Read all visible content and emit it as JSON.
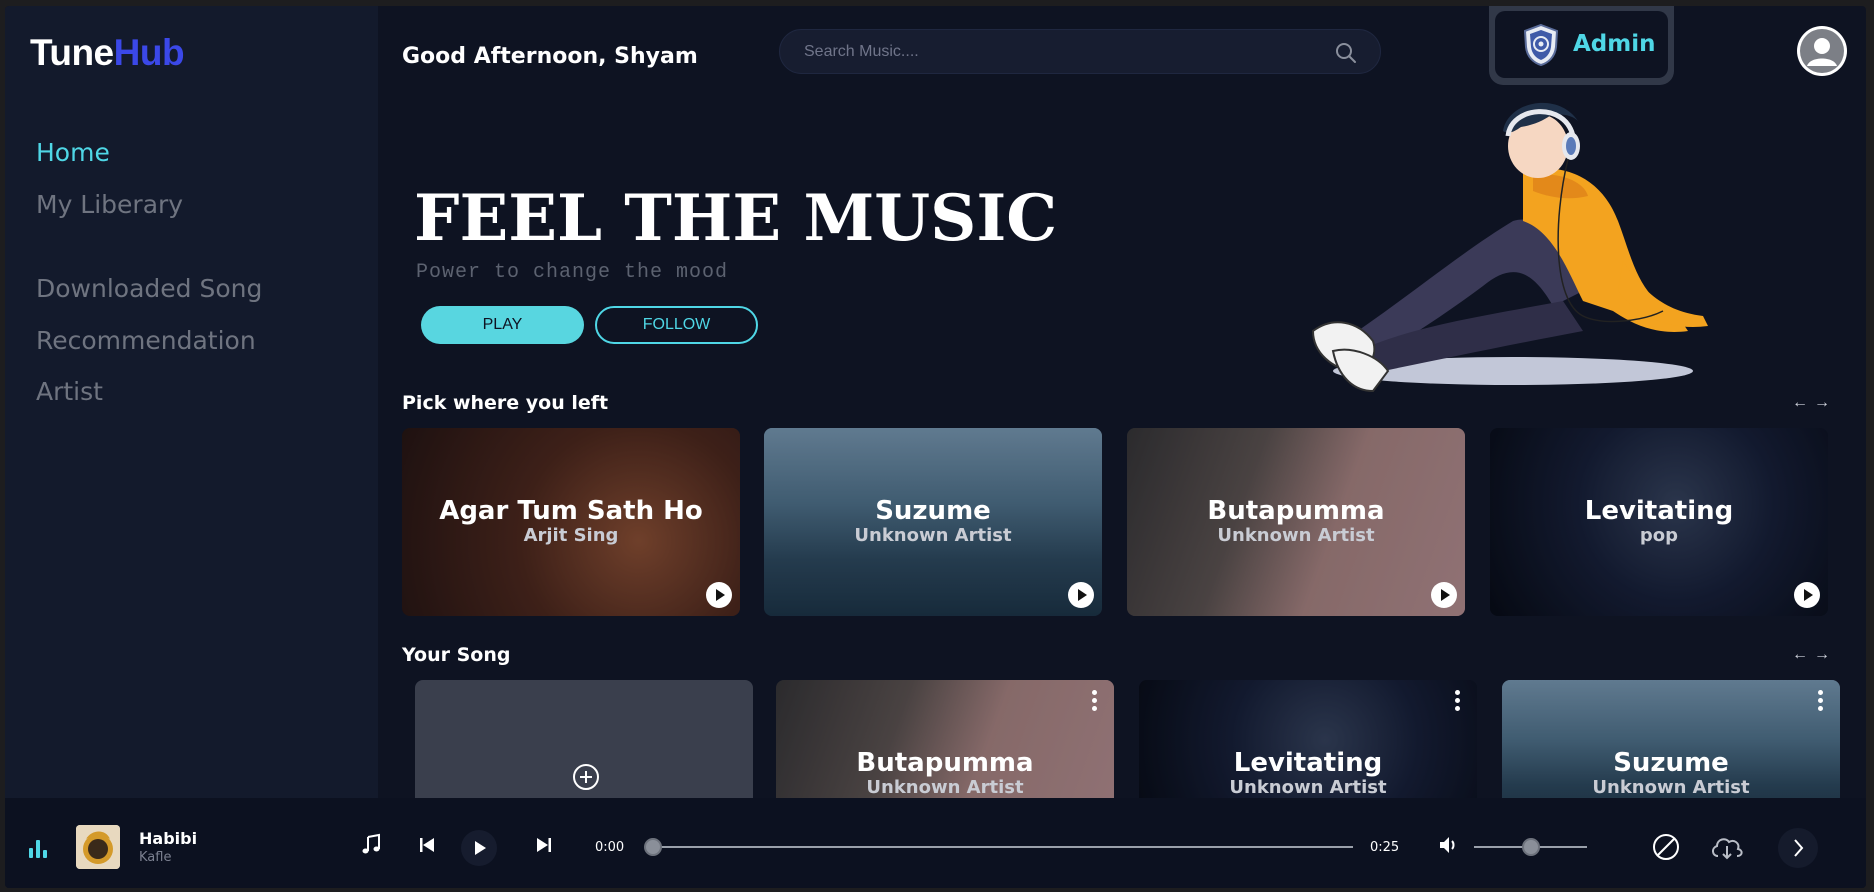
{
  "brand": {
    "part1": "Tune",
    "part2": "Hub"
  },
  "sidebar": {
    "items": [
      {
        "label": "Home",
        "active": true
      },
      {
        "label": "My Liberary"
      },
      {
        "label": "Downloaded Song"
      },
      {
        "label": "Recommendation"
      },
      {
        "label": "Artist"
      }
    ]
  },
  "header": {
    "greeting": "Good Afternoon, Shyam",
    "search_placeholder": "Search Music....",
    "admin_label": "Admin"
  },
  "hero": {
    "title": "FEEL THE MUSIC",
    "subtitle": "Power to change the mood",
    "play_label": "PLAY",
    "follow_label": "FOLLOW"
  },
  "sections": {
    "pick": {
      "title": "Pick where you left",
      "prev": "←",
      "next": "→",
      "cards": [
        {
          "title": "Agar Tum Sath Ho",
          "subtitle": "Arjit Sing"
        },
        {
          "title": "Suzume",
          "subtitle": "Unknown Artist"
        },
        {
          "title": "Butapumma",
          "subtitle": "Unknown Artist"
        },
        {
          "title": "Levitating",
          "subtitle": "pop"
        }
      ]
    },
    "yours": {
      "title": "Your Song",
      "prev": "←",
      "next": "→",
      "cards": [
        {
          "title": "Butapumma",
          "subtitle": "Unknown Artist"
        },
        {
          "title": "Levitating",
          "subtitle": "Unknown Artist"
        },
        {
          "title": "Suzume",
          "subtitle": "Unknown Artist"
        }
      ]
    }
  },
  "player": {
    "song": "Habibi",
    "artist": "Kafle",
    "current_time": "0:00",
    "duration": "0:25",
    "progress": 0,
    "volume": 0.5
  },
  "colors": {
    "accent": "#4fd7e6",
    "brand_blue": "#3b48e8",
    "background": "#0e1322",
    "sidebar": "#131a2c"
  }
}
